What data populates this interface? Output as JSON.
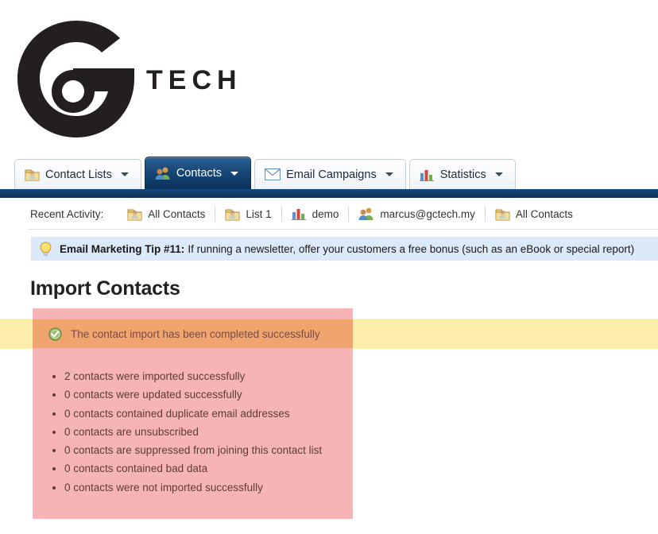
{
  "brand": {
    "logo_icon": "gtech-g-logo-icon",
    "wordmark": "TECH"
  },
  "tabs": [
    {
      "label": "Contact Lists",
      "icon": "contact-list-icon",
      "active": false
    },
    {
      "label": "Contacts",
      "icon": "contacts-people-icon",
      "active": true
    },
    {
      "label": "Email Campaigns",
      "icon": "envelope-icon",
      "active": false
    },
    {
      "label": "Statistics",
      "icon": "bar-chart-icon",
      "active": false
    }
  ],
  "recent_activity": {
    "label": "Recent Activity:",
    "items": [
      {
        "label": "All Contacts",
        "icon": "contact-list-icon"
      },
      {
        "label": "List 1",
        "icon": "contact-list-icon"
      },
      {
        "label": "demo",
        "icon": "bar-chart-icon"
      },
      {
        "label": "marcus@gctech.my",
        "icon": "contacts-people-icon"
      },
      {
        "label": "All Contacts",
        "icon": "contact-list-icon"
      }
    ]
  },
  "tip": {
    "icon": "lightbulb-icon",
    "title": "Email Marketing Tip #11:",
    "body": "If running a newsletter, offer your customers a free bonus (such as an eBook or special report)"
  },
  "page": {
    "title": "Import Contacts"
  },
  "result": {
    "status_icon": "green-check-circle-icon",
    "status_text": "The contact import has been completed successfully",
    "summary": [
      "2 contacts were imported successfully",
      "0 contacts were updated successfully",
      "0 contacts contained duplicate email addresses",
      "0 contacts are unsubscribed",
      "0 contacts are suppressed from joining this contact list",
      "0 contacts contained bad data",
      "0 contacts were not imported successfully"
    ]
  },
  "colors": {
    "tab_active_blue": "#164676",
    "navy_bar": "#0e3a61",
    "tip_bar_blue": "#dce9f8",
    "yellow_strip": "#fdeeab",
    "pink_panel": "#f7b4b6",
    "orange_success": "#f0a46e",
    "status_green": "#7ba446"
  }
}
